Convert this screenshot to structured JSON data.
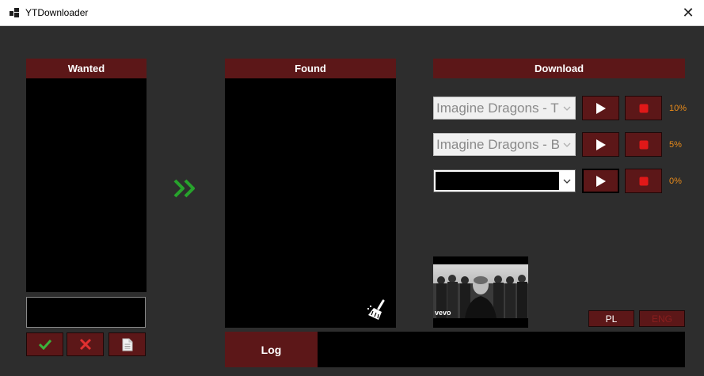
{
  "window": {
    "title": "YTDownloader",
    "close_glyph": "✕"
  },
  "wanted": {
    "header": "Wanted",
    "input_value": ""
  },
  "found": {
    "header": "Found"
  },
  "download": {
    "header": "Download",
    "rows": [
      {
        "track": "Imagine Dragons - T",
        "progress": "10%"
      },
      {
        "track": "Imagine Dragons - B",
        "progress": "5%"
      },
      {
        "track": "",
        "progress": "0%"
      }
    ]
  },
  "thumbnail": {
    "watermark": "vevo"
  },
  "log": {
    "label": "Log",
    "content": ""
  },
  "language": {
    "pl": "PL",
    "eng": "ENG"
  },
  "icons": {
    "app": "app-windows-icon",
    "transfer": "double-chevron-right-icon",
    "confirm": "checkmark-icon",
    "remove": "x-icon",
    "file": "document-icon",
    "clear": "broom-icon",
    "play": "play-icon",
    "stop": "stop-icon"
  },
  "colors": {
    "panel_header": "#5c1718",
    "background": "#2d2d2d",
    "progress_text": "#e98b1a",
    "confirm_green": "#3bb33b",
    "remove_red": "#e03030",
    "stop_red": "#e01818"
  }
}
